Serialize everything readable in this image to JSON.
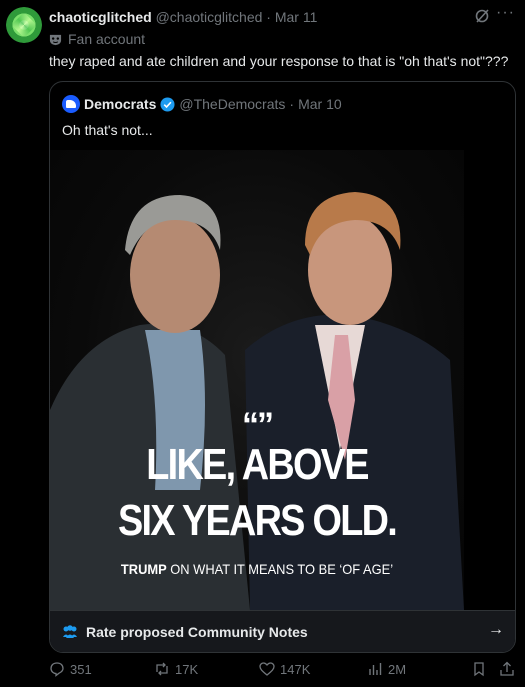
{
  "tweet": {
    "author_name": "chaoticglitched",
    "author_handle": "@chaoticglitched",
    "separator": "·",
    "date": "Mar 11",
    "badge_label": "Fan account",
    "text": "they raped and ate children and your response to that is \"oh that's not\"???"
  },
  "quoted": {
    "author_name": "Democrats",
    "author_handle": "@TheDemocrats",
    "separator": "·",
    "date": "Mar 10",
    "text": "Oh that's not...",
    "image": {
      "quote_marks": "“”",
      "headline_line1": "LIKE, ABOVE",
      "headline_line2": "SIX YEARS OLD.",
      "caption_name": "TRUMP",
      "caption_rest": " ON WHAT IT MEANS TO BE ‘OF AGE’"
    },
    "community_notes_label": "Rate proposed Community Notes",
    "arrow": "→"
  },
  "actions": {
    "replies": "351",
    "reposts": "17K",
    "likes": "147K",
    "views": "2M"
  },
  "more_label": "···",
  "colors": {
    "background": "#000000",
    "text": "#e7e9ea",
    "muted": "#71767b",
    "border": "#2f3336",
    "verified": "#1d9bf0",
    "notes_icon": "#1d9bf0"
  }
}
